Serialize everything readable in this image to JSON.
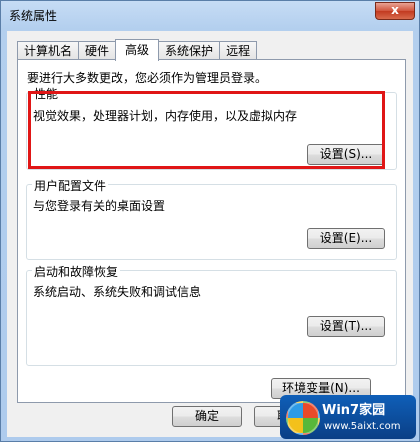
{
  "window": {
    "title": "系统属性",
    "close_glyph": "x"
  },
  "tabs": [
    {
      "label": "计算机名"
    },
    {
      "label": "硬件"
    },
    {
      "label": "高级",
      "active": true
    },
    {
      "label": "系统保护"
    },
    {
      "label": "远程"
    }
  ],
  "advanced": {
    "admin_note": "要进行大多数更改，您必须作为管理员登录。",
    "performance": {
      "title": "性能",
      "description": "视觉效果，处理器计划，内存使用，以及虚拟内存",
      "settings_label": "设置(S)..."
    },
    "user_profiles": {
      "title": "用户配置文件",
      "description": "与您登录有关的桌面设置",
      "settings_label": "设置(E)..."
    },
    "startup_recovery": {
      "title": "启动和故障恢复",
      "description": "系统启动、系统失败和调试信息",
      "settings_label": "设置(T)..."
    },
    "env_vars_label": "环境变量(N)..."
  },
  "footer": {
    "ok_label": "确定",
    "cancel_label": "取消"
  },
  "watermark": {
    "text": "Win7家园",
    "url": "www.5aixt.com"
  },
  "colors": {
    "highlight_border": "#e01616",
    "close_button": "#c23a20"
  },
  "icons": {
    "close": "close-icon",
    "logo": "windows-logo-icon"
  }
}
